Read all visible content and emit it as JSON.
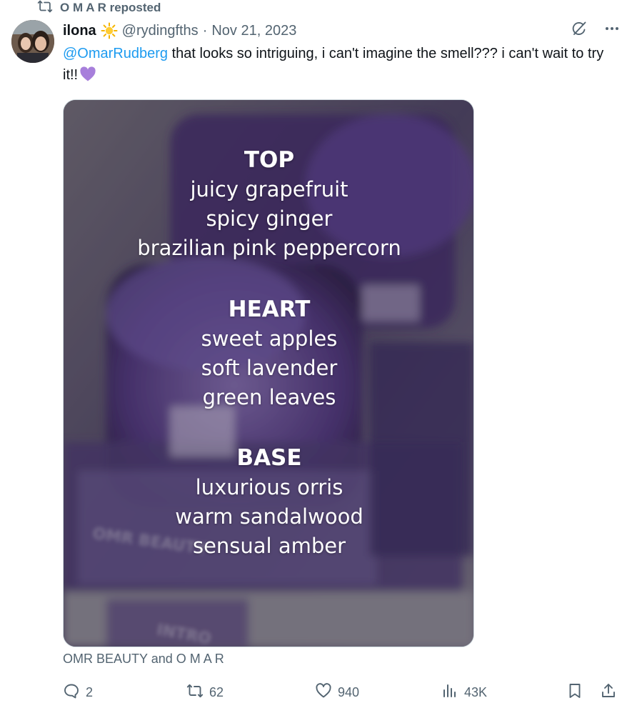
{
  "repost": {
    "name": "O M A R",
    "suffix": "reposted",
    "icon": "repost-icon"
  },
  "tweet": {
    "author_name": "ilona",
    "author_emoji": "sun-emoji",
    "handle": "@rydingfths",
    "separator": "·",
    "date": "Nov 21, 2023",
    "mention": "@OmarRudberg",
    "text": " that looks so intriguing, i can't imagine the smell??? i can't wait to try it!!",
    "trailing_emoji": "purple-heart-emoji"
  },
  "media": {
    "notes": {
      "top_heading": "TOP",
      "top": [
        "juicy grapefruit",
        "spicy ginger",
        "brazilian pink peppercorn"
      ],
      "heart_heading": "HEART",
      "heart": [
        "sweet apples",
        "soft lavender",
        "green leaves"
      ],
      "base_heading": "BASE",
      "base": [
        "luxurious orris",
        "warm sandalwood",
        "sensual amber"
      ]
    },
    "background_text": [
      "OMR BEAUTY",
      "INTRO"
    ],
    "credit": "OMR BEAUTY and O M A R"
  },
  "actions": {
    "replies": "2",
    "reposts": "62",
    "likes": "940",
    "views": "43K"
  },
  "colors": {
    "accent": "#1d9bf0",
    "secondary_text": "#536471",
    "primary_text": "#0f1419",
    "image_purple": "#5b3f8f"
  }
}
